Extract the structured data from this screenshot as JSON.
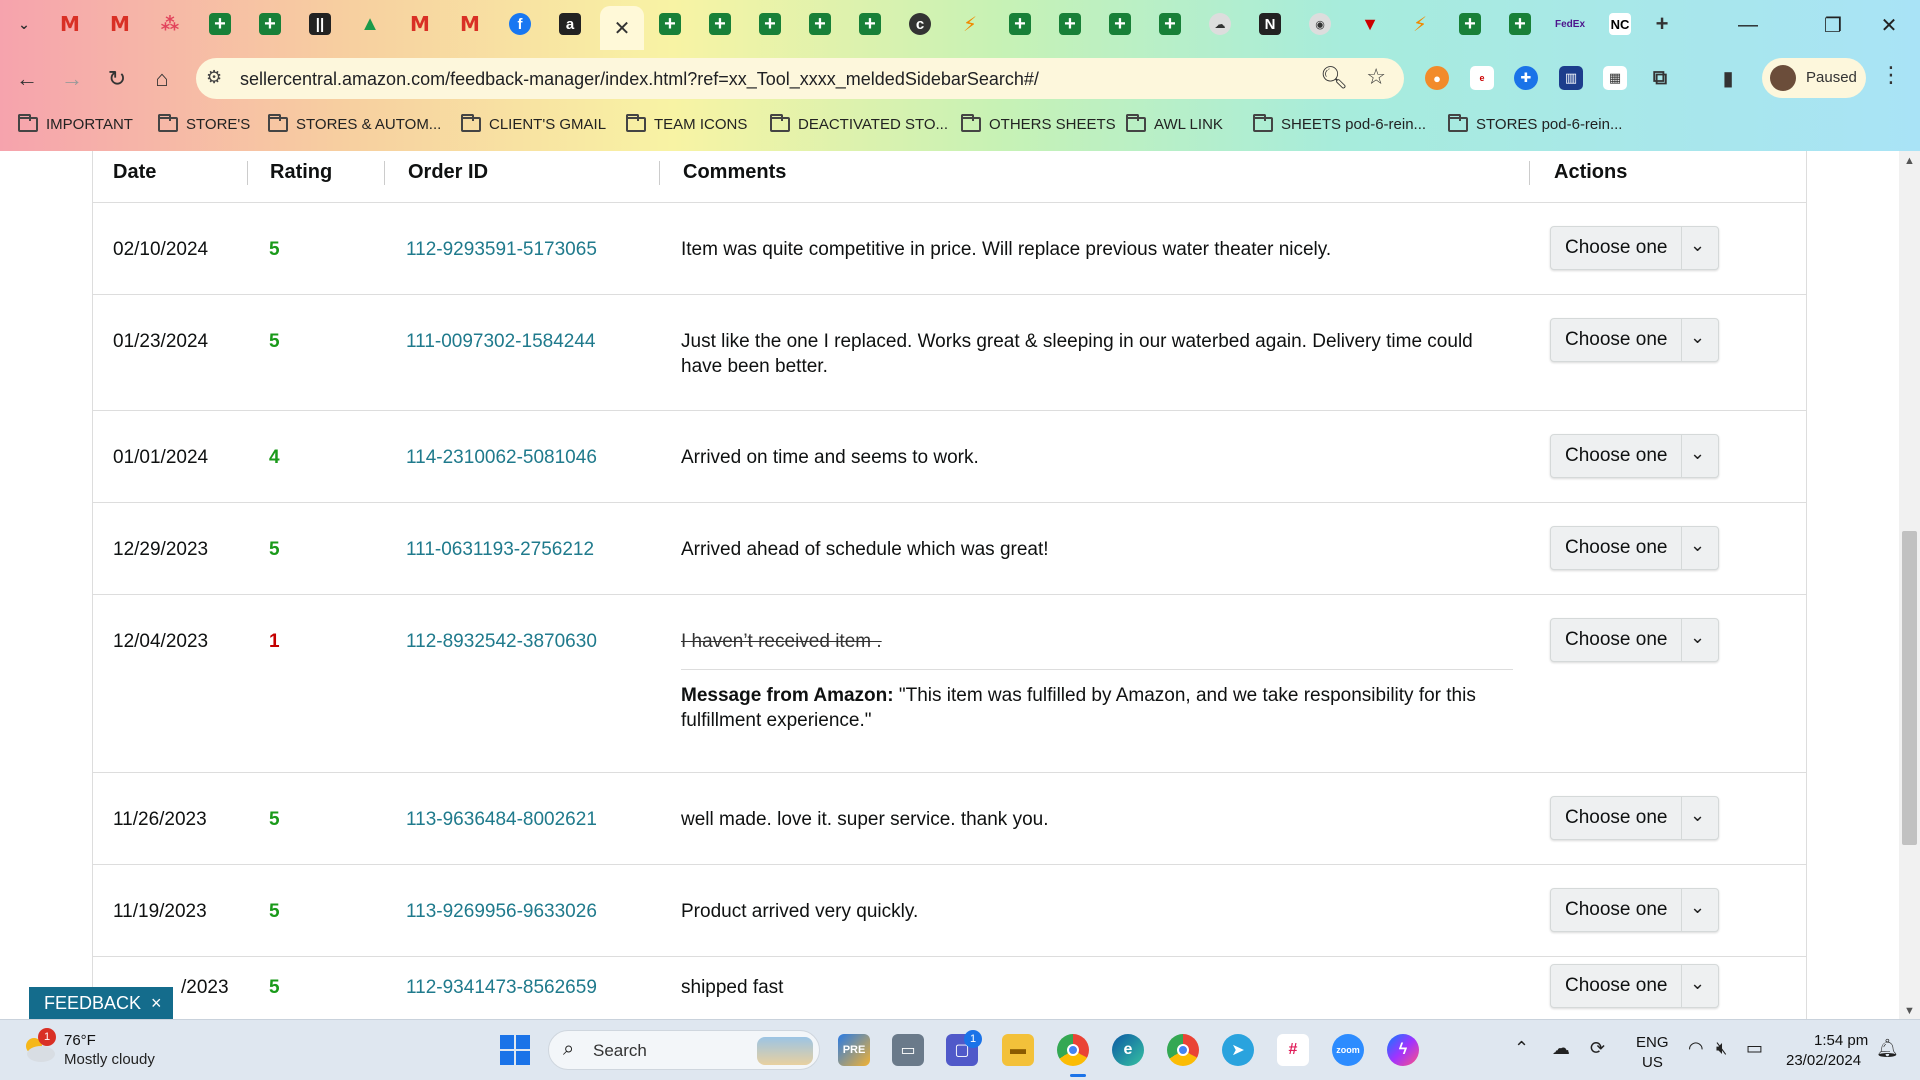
{
  "browser": {
    "url": "sellercentral.amazon.com/feedback-manager/index.html?ref=xx_Tool_xxxx_meldedSidebarSearch#/",
    "profile_label": "Paused",
    "tab_icons": [
      "gmail-icon",
      "gmail-icon",
      "app-icon",
      "sheets-icon",
      "sheets-icon",
      "bars-icon",
      "drive-icon",
      "gmail-icon",
      "gmail-icon",
      "facebook-icon",
      "amazon-icon",
      "close-icon",
      "sheets-icon",
      "sheets-icon",
      "sheets-icon",
      "sheets-icon",
      "sheets-icon",
      "circle-c-icon",
      "bolt-icon",
      "sheets-icon",
      "sheets-icon",
      "sheets-icon",
      "sheets-icon",
      "cloud-icon",
      "n-icon",
      "badge-icon",
      "shield-icon",
      "bolt-icon",
      "sheets-icon",
      "sheets-icon",
      "fedex-icon",
      "nc-icon",
      "new-tab-icon"
    ],
    "bookmarks": [
      {
        "label": "IMPORTANT"
      },
      {
        "label": "STORE'S"
      },
      {
        "label": "STORES & AUTOM..."
      },
      {
        "label": "CLIENT'S GMAIL"
      },
      {
        "label": "TEAM ICONS"
      },
      {
        "label": "DEACTIVATED STO..."
      },
      {
        "label": "OTHERS SHEETS"
      },
      {
        "label": "AWL LINK"
      },
      {
        "label": "SHEETS pod-6-rein..."
      },
      {
        "label": "STORES pod-6-rein..."
      }
    ]
  },
  "table": {
    "headers": {
      "date": "Date",
      "rating": "Rating",
      "order_id": "Order ID",
      "comments": "Comments",
      "actions": "Actions"
    },
    "action_label": "Choose one",
    "rows": [
      {
        "date": "02/10/2024",
        "rating": "5",
        "order_id": "112-9293591-5173065",
        "comment": "Item was quite competitive in price. Will replace previous water theater nicely."
      },
      {
        "date": "01/23/2024",
        "rating": "5",
        "order_id": "111-0097302-1584244",
        "comment": "Just like the one I replaced. Works great & sleeping in our waterbed again. Delivery time could have been better."
      },
      {
        "date": "01/01/2024",
        "rating": "4",
        "order_id": "114-2310062-5081046",
        "comment": "Arrived on time and seems to work."
      },
      {
        "date": "12/29/2023",
        "rating": "5",
        "order_id": "111-0631193-2756212",
        "comment": "Arrived ahead of schedule which was great!"
      },
      {
        "date": "12/04/2023",
        "rating": "1",
        "order_id": "112-8932542-3870630",
        "comment": "I haven’t received item .",
        "amazon_label": "Message from Amazon:",
        "amazon_text": " \"This item was fulfilled by Amazon, and we take responsibility for this fulfillment experience.\""
      },
      {
        "date": "11/26/2023",
        "rating": "5",
        "order_id": "113-9636484-8002621",
        "comment": "well made. love it. super service. thank you."
      },
      {
        "date": "11/19/2023",
        "rating": "5",
        "order_id": "113-9269956-9633026",
        "comment": "Product arrived very quickly."
      },
      {
        "date": "/2023",
        "rating": "5",
        "order_id": "112-9341473-8562659",
        "comment": "shipped fast"
      }
    ]
  },
  "feedback_tab": {
    "label": "FEEDBACK",
    "close": "×"
  },
  "taskbar": {
    "weather_temp": "76°F",
    "weather_desc": "Mostly cloudy",
    "weather_badge": "1",
    "search_label": "Search",
    "chat_badge": "1",
    "lang_1": "ENG",
    "lang_2": "US",
    "time": "1:54 pm",
    "date": "23/02/2024"
  },
  "colors": {
    "rating_good": "#1a9a1a",
    "rating_bad": "#c40000",
    "order_link": "#1f7a8c",
    "feedback_tab": "#146c8c"
  }
}
